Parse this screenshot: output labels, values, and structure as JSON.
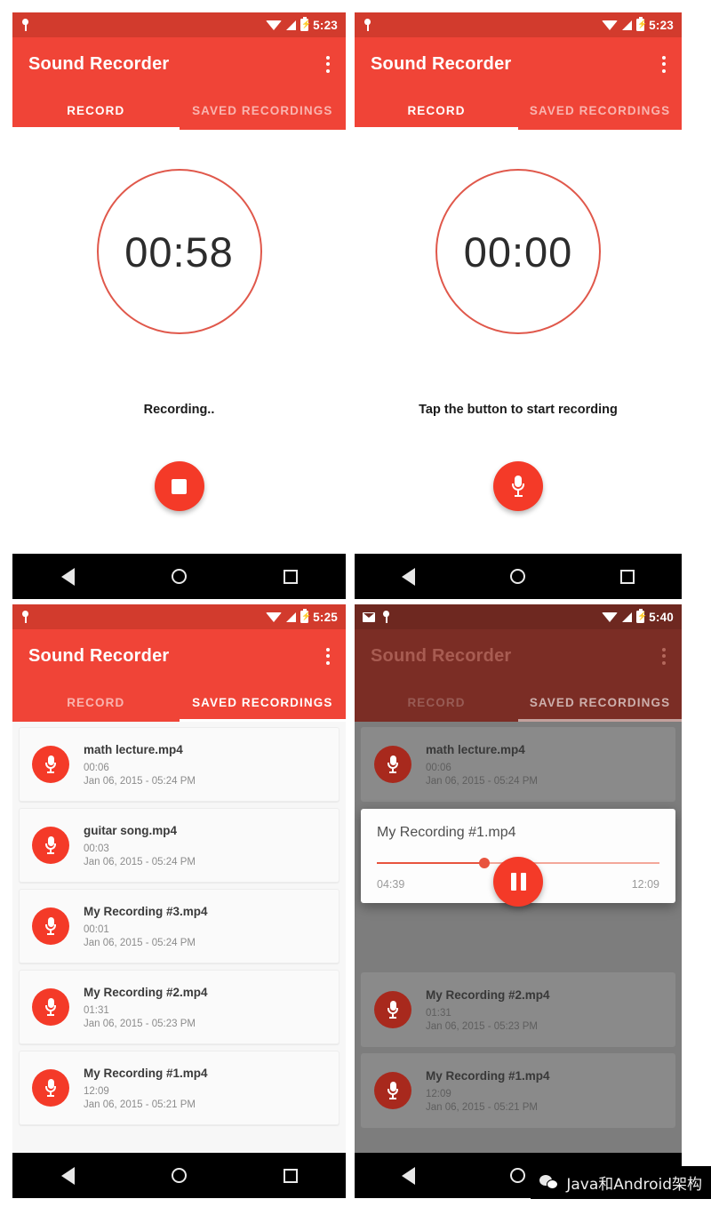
{
  "app": {
    "title": "Sound Recorder",
    "accent_red": "#F04437",
    "status_red": "#D23B2D",
    "fab_red": "#F43A28"
  },
  "tabs": {
    "record": "RECORD",
    "saved": "SAVED RECORDINGS"
  },
  "panels": {
    "recording": {
      "status_time": "5:23",
      "timer": "00:58",
      "hint": "Recording..",
      "fab_icon": "stop-icon",
      "active_tab": "RECORD"
    },
    "idle": {
      "status_time": "5:23",
      "timer": "00:00",
      "hint": "Tap the button to start recording",
      "fab_icon": "microphone-icon",
      "active_tab": "RECORD"
    },
    "saved_list": {
      "status_time": "5:25",
      "active_tab": "SAVED RECORDINGS",
      "recordings": [
        {
          "name": "math lecture.mp4",
          "duration": "00:06",
          "date": "Jan 06, 2015 - 05:24 PM"
        },
        {
          "name": "guitar song.mp4",
          "duration": "00:03",
          "date": "Jan 06, 2015 - 05:24 PM"
        },
        {
          "name": "My Recording #3.mp4",
          "duration": "00:01",
          "date": "Jan 06, 2015 - 05:24 PM"
        },
        {
          "name": "My Recording #2.mp4",
          "duration": "01:31",
          "date": "Jan 06, 2015 - 05:23 PM"
        },
        {
          "name": "My Recording #1.mp4",
          "duration": "12:09",
          "date": "Jan 06, 2015 - 05:21 PM"
        }
      ]
    },
    "player": {
      "status_time": "5:40",
      "active_tab": "SAVED RECORDINGS",
      "dialog": {
        "title": "My Recording #1.mp4",
        "elapsed": "04:39",
        "total": "12:09",
        "progress_percent": 38,
        "fab_icon": "pause-icon"
      },
      "background_recordings": [
        {
          "name": "math lecture.mp4",
          "duration": "00:06",
          "date": "Jan 06, 2015 - 05:24 PM"
        },
        {
          "name": "My Recording #2.mp4",
          "duration": "01:31",
          "date": "Jan 06, 2015 - 05:23 PM"
        },
        {
          "name": "My Recording #1.mp4",
          "duration": "12:09",
          "date": "Jan 06, 2015 - 05:21 PM"
        }
      ]
    }
  },
  "watermark": {
    "text": "Java和Android架构",
    "icon": "wechat-icon"
  }
}
